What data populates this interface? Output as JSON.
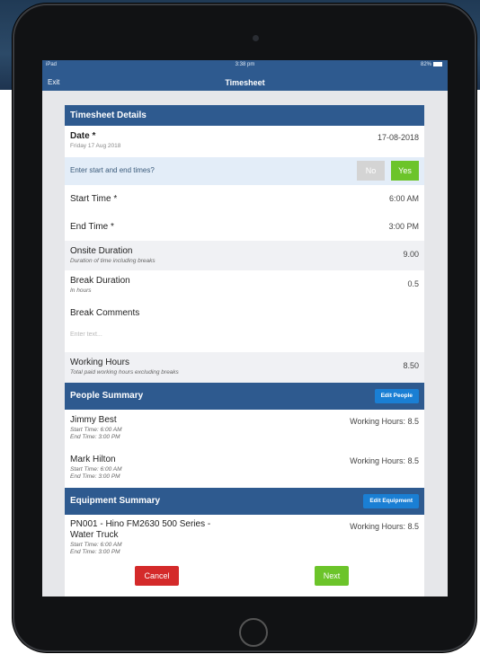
{
  "statusbar": {
    "carrier": "iPad",
    "time": "3:38 pm",
    "battery": "82%"
  },
  "nav": {
    "exit_label": "Exit",
    "title": "Timesheet"
  },
  "details": {
    "header": "Timesheet Details",
    "date_label": "Date *",
    "date_sub": "Friday 17 Aug 2018",
    "date_value": "17-08-2018",
    "enter_times_question": "Enter start and end times?",
    "no_label": "No",
    "yes_label": "Yes",
    "start_label": "Start Time *",
    "start_value": "6:00 AM",
    "end_label": "End Time *",
    "end_value": "3:00 PM",
    "onsite_label": "Onsite Duration",
    "onsite_sub": "Duration of time including breaks",
    "onsite_value": "9.00",
    "break_label": "Break Duration",
    "break_sub": "In hours",
    "break_value": "0.5",
    "comments_label": "Break Comments",
    "comments_placeholder": "Enter text...",
    "working_label": "Working Hours",
    "working_sub": "Total paid working hours excluding breaks",
    "working_value": "8.50"
  },
  "people": {
    "header": "People Summary",
    "edit_label": "Edit People",
    "items": [
      {
        "name": "Jimmy Best",
        "start": "Start Time: 6:00 AM",
        "end": "End Time: 3:00 PM",
        "hours": "Working Hours: 8.5"
      },
      {
        "name": "Mark Hilton",
        "start": "Start Time: 6:00 AM",
        "end": "End Time: 3:00 PM",
        "hours": "Working Hours: 8.5"
      }
    ]
  },
  "equipment": {
    "header": "Equipment Summary",
    "edit_label": "Edit Equipment",
    "items": [
      {
        "name_line1": "PN001 - Hino FM2630 500 Series -",
        "name_line2": "Water Truck",
        "start": "Start Time: 6:00 AM",
        "end": "End Time: 3:00 PM",
        "hours": "Working Hours: 8.5"
      }
    ]
  },
  "actions": {
    "cancel_label": "Cancel",
    "next_label": "Next"
  },
  "colors": {
    "header_blue": "#2e5a8f",
    "edit_blue": "#1a7fd4",
    "yes_green": "#6cc42a",
    "cancel_red": "#d42a2a",
    "no_gray": "#d4d4d4"
  }
}
